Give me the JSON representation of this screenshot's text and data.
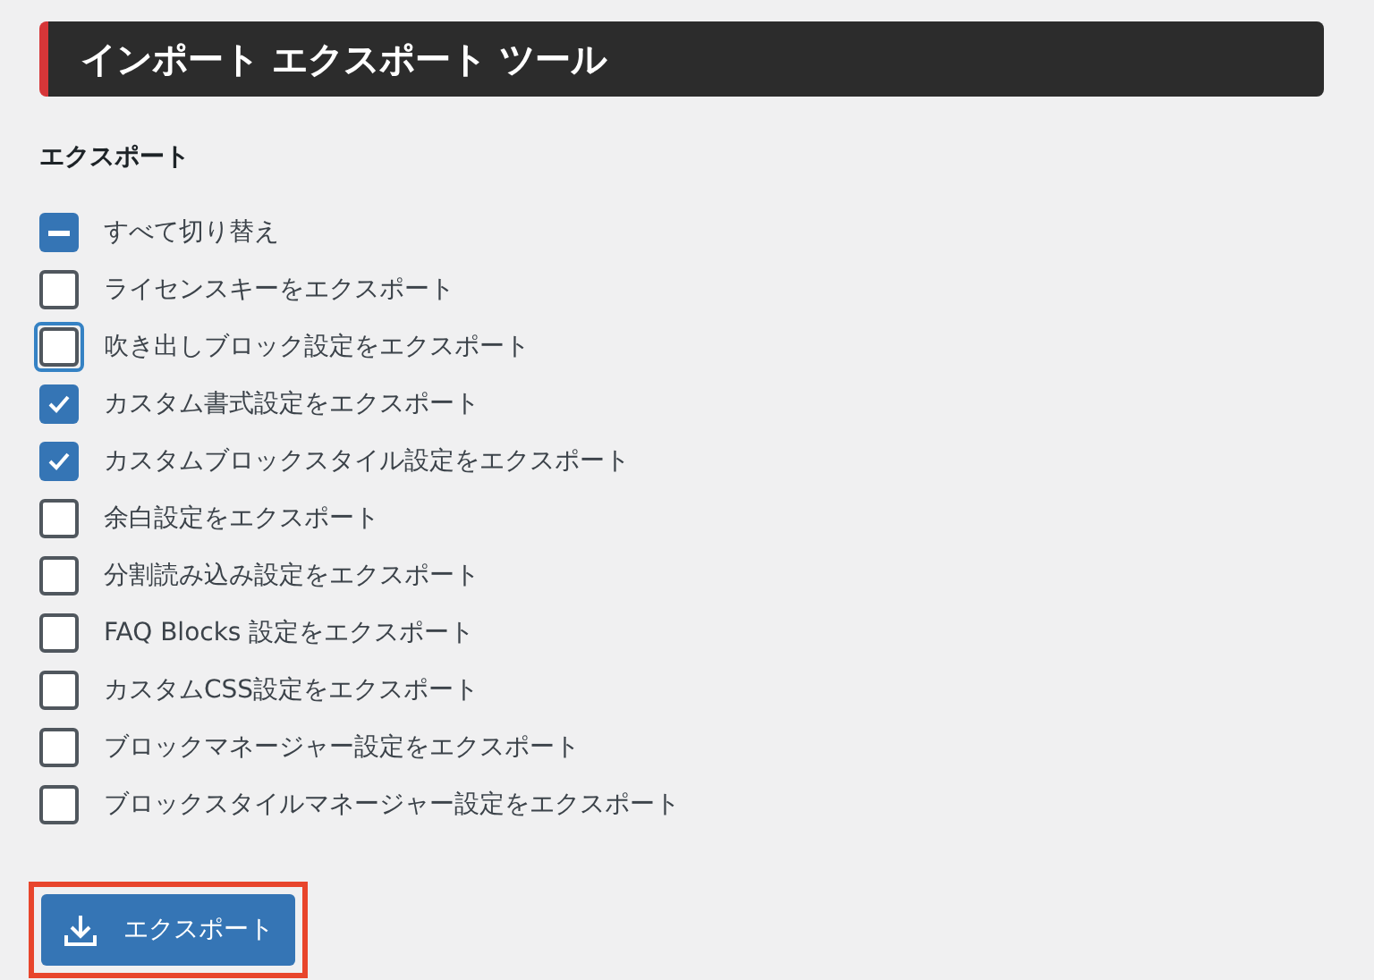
{
  "header": {
    "title": "インポート エクスポート ツール"
  },
  "section": {
    "title": "エクスポート"
  },
  "options": [
    {
      "label": "すべて切り替え",
      "checked": false,
      "indeterminate": true,
      "focused": false
    },
    {
      "label": "ライセンスキーをエクスポート",
      "checked": false,
      "indeterminate": false,
      "focused": false
    },
    {
      "label": "吹き出しブロック設定をエクスポート",
      "checked": false,
      "indeterminate": false,
      "focused": true
    },
    {
      "label": "カスタム書式設定をエクスポート",
      "checked": true,
      "indeterminate": false,
      "focused": false
    },
    {
      "label": "カスタムブロックスタイル設定をエクスポート",
      "checked": true,
      "indeterminate": false,
      "focused": false
    },
    {
      "label": "余白設定をエクスポート",
      "checked": false,
      "indeterminate": false,
      "focused": false
    },
    {
      "label": "分割読み込み設定をエクスポート",
      "checked": false,
      "indeterminate": false,
      "focused": false
    },
    {
      "label": "FAQ Blocks 設定をエクスポート",
      "checked": false,
      "indeterminate": false,
      "focused": false
    },
    {
      "label": "カスタムCSS設定をエクスポート",
      "checked": false,
      "indeterminate": false,
      "focused": false
    },
    {
      "label": "ブロックマネージャー設定をエクスポート",
      "checked": false,
      "indeterminate": false,
      "focused": false
    },
    {
      "label": "ブロックスタイルマネージャー設定をエクスポート",
      "checked": false,
      "indeterminate": false,
      "focused": false
    }
  ],
  "export_button": {
    "label": "エクスポート",
    "highlighted": true
  }
}
